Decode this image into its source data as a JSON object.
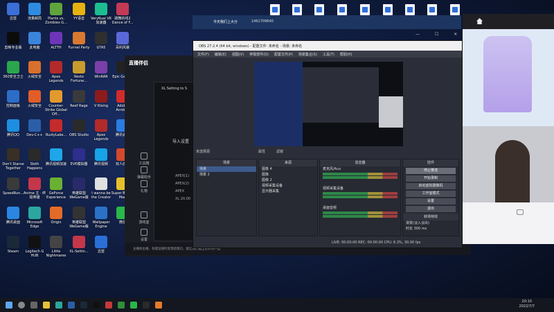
{
  "desktop_icons": [
    {
      "label": "迅雷",
      "color": "#3a6fd8"
    },
    {
      "label": "流量邮局",
      "color": "#2f8be0"
    },
    {
      "label": "Plants vs. Zombies G...",
      "color": "#5fa53c"
    },
    {
      "label": "YY语音",
      "color": "#e5b20f"
    },
    {
      "label": "VeryKuai VK 加速器",
      "color": "#1dbd92"
    },
    {
      "label": "跳舞的线2 Dance of F...",
      "color": "#c33a56"
    },
    {
      "label": "剪映专业版",
      "color": "#0c0c0c"
    },
    {
      "label": "此电脑",
      "color": "#3b84db"
    },
    {
      "label": "ALTTH",
      "color": "#6e35b8"
    },
    {
      "label": "Funnel Party",
      "color": "#d8792f"
    },
    {
      "label": "GTA5",
      "color": "#2f2f2f"
    },
    {
      "label": "百利风暴",
      "color": "#5a69d9"
    },
    {
      "label": "360安全卫士",
      "color": "#2aa64d"
    },
    {
      "label": "火绒安全",
      "color": "#d9702c"
    },
    {
      "label": "Apex Legends",
      "color": "#b32a2a"
    },
    {
      "label": "Resto Fortune...",
      "color": "#c89b2c"
    },
    {
      "label": "WinRAR",
      "color": "#7b3fa8"
    },
    {
      "label": "Epic Games",
      "color": "#222"
    },
    {
      "label": "控制面板",
      "color": "#2d6cc7"
    },
    {
      "label": "火绒安全",
      "color": "#e25d27"
    },
    {
      "label": "Counter-Strike Global Off...",
      "color": "#e39a2c"
    },
    {
      "label": "Reef Rage",
      "color": "#3a3a3a"
    },
    {
      "label": "V Rising",
      "color": "#8c1c1c"
    },
    {
      "label": "Adobe Acrobat",
      "color": "#d12b2b"
    },
    {
      "label": "腾讯QQ",
      "color": "#1e8fe0"
    },
    {
      "label": "Dev-C++",
      "color": "#2a5fa8"
    },
    {
      "label": "RustyLake...",
      "color": "#c42b2b"
    },
    {
      "label": "OBS Studio",
      "color": "#2a2a2a"
    },
    {
      "label": "Apex Legends",
      "color": "#b32a2a"
    },
    {
      "label": "腾讯会议",
      "color": "#2a7ce0"
    },
    {
      "label": "Don't Starve Together",
      "color": "#3a2f24"
    },
    {
      "label": "Sloth Happens",
      "color": "#2a2a2a"
    },
    {
      "label": "腾讯视频加速",
      "color": "#1fa6e8"
    },
    {
      "label": "EVE模拟器",
      "color": "#2e2e8c"
    },
    {
      "label": "腾讯视频",
      "color": "#17a3e6"
    },
    {
      "label": "双人成行",
      "color": "#d24a2d"
    },
    {
      "label": "SpeedRun...",
      "color": "#3a3a3a"
    },
    {
      "label": "Anime 主 · 终极英雄",
      "color": "#c4374a"
    },
    {
      "label": "GeForce Experience",
      "color": "#6ab133"
    },
    {
      "label": "英雄联盟 WeGame版",
      "color": "#2a2a6a"
    },
    {
      "label": "I wanna be the Creator",
      "color": "#e0e0e0"
    },
    {
      "label": "Super Bunny Man",
      "color": "#e5c02c"
    },
    {
      "label": "腾讯桌面",
      "color": "#2a86e0"
    },
    {
      "label": "Microsoft Edge",
      "color": "#2ba7a0"
    },
    {
      "label": "Origin",
      "color": "#e26b27"
    },
    {
      "label": "英雄联盟 WeGame版",
      "color": "#333"
    },
    {
      "label": "Wallpaper Engine",
      "color": "#2a72c7"
    },
    {
      "label": "微信",
      "color": "#29b74a"
    },
    {
      "label": "Steam",
      "color": "#1b2838"
    },
    {
      "label": "Logitech G HUB",
      "color": "#111"
    },
    {
      "label": "Little Nightmares",
      "color": "#444"
    },
    {
      "label": "XL-Settin...",
      "color": "#c4374a"
    },
    {
      "label": "迅雷",
      "color": "#2a6fd8"
    }
  ],
  "live_app": {
    "logo": "直播伴侣",
    "side_items": [
      "工具箱",
      "弹幕助手",
      "礼物",
      "游戏室",
      "设置"
    ],
    "bottom_tip": "主播很主播，有建议随时反馈给我们，能让我们推出更好的产品"
  },
  "xl_dialog": {
    "title": "XL Setting to S",
    "import_label": "导入设置",
    "options": [
      "APEX(1)",
      "APEX(2)",
      "APEX",
      "XL 20.00"
    ]
  },
  "live_title": "今天我们上大分",
  "live_id": "1461709640",
  "obs": {
    "title": "OBS 27.2.4 (64 bit, windows) - 配置文件: 未命名 - 场景: 未命名",
    "menu": [
      "文件(F)",
      "编辑(E)",
      "视图(V)",
      "停靠部件(D)",
      "配置文件(P)",
      "场景集合(S)",
      "工具(T)",
      "帮助(H)"
    ],
    "source_hint": "未选择源",
    "source_props": "属性",
    "source_filters": "滤镜",
    "scenes_header": "场景",
    "scenes": [
      "场景",
      "场景 2"
    ],
    "sources_header": "来源",
    "sources": [
      "图像 4",
      "图像",
      "图像 2",
      "视频采集设备",
      "显示器采集"
    ],
    "mixer_header": "混音器",
    "mixer_channels": [
      "麦克风/Aux",
      "视频采集设备",
      "桌面音频"
    ],
    "controls_header": "控件",
    "controls": [
      "停止推流",
      "开始录制",
      "启动虚拟摄像机",
      "工作室模式",
      "设置",
      "退出"
    ],
    "transition_header": "转场特效",
    "transition_value": "渐变(淡入淡出)",
    "duration_label": "时长",
    "duration_value": "300 ms",
    "status": "LIVE: 00:00:00   REC: 00:00:00   CPU: 6.3%, 30.00 fps"
  },
  "taskbar": {
    "time": "20:10",
    "date": "2022/7/7"
  }
}
